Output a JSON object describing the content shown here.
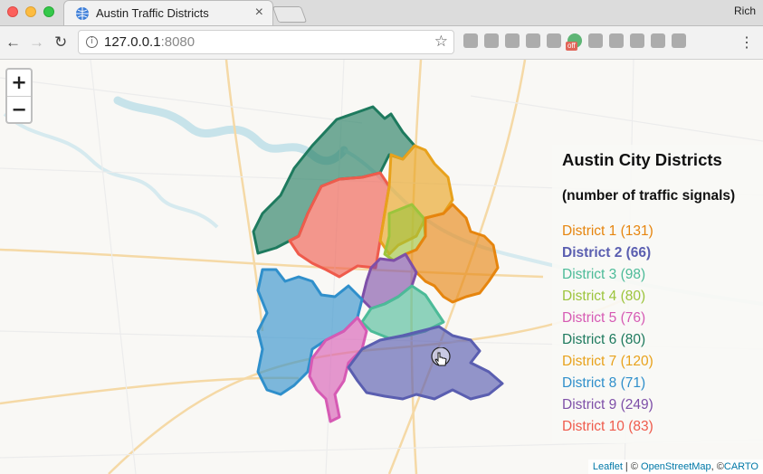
{
  "browser": {
    "tab_title": "Austin Traffic Districts",
    "tab_close": "×",
    "profile_name": "Rich",
    "url_host": "127.0.0.1",
    "url_port": ":8080",
    "info_icon": "i",
    "back_icon": "←",
    "forward_icon": "→",
    "reload_icon": "↻",
    "star_icon": "☆",
    "menu_icon": "⋮",
    "extension_badge": "off"
  },
  "map": {
    "zoom_in": "+",
    "zoom_out": "−",
    "legend": {
      "title": "Austin City Districts",
      "subtitle": "(number of traffic signals)",
      "items": [
        {
          "label": "District 1 (131)",
          "color": "#e6850e",
          "active": false
        },
        {
          "label": "District 2 (66)",
          "color": "#5a5eb0",
          "active": true
        },
        {
          "label": "District 3 (98)",
          "color": "#4cbb98",
          "active": false
        },
        {
          "label": "District 4 (80)",
          "color": "#9cc43c",
          "active": false
        },
        {
          "label": "District 5 (76)",
          "color": "#d65ab4",
          "active": false
        },
        {
          "label": "District 6 (80)",
          "color": "#1e7a5e",
          "active": false
        },
        {
          "label": "District 7 (120)",
          "color": "#e8a21c",
          "active": false
        },
        {
          "label": "District 8 (71)",
          "color": "#2f8fcb",
          "active": false
        },
        {
          "label": "District 9 (249)",
          "color": "#7e4fa8",
          "active": false
        },
        {
          "label": "District 10 (83)",
          "color": "#ef5b4c",
          "active": false
        }
      ]
    },
    "attribution": {
      "leaflet": "Leaflet",
      "sep1": " | © ",
      "osm": "OpenStreetMap",
      "sep2": ", ©",
      "carto": "CARTO"
    }
  }
}
